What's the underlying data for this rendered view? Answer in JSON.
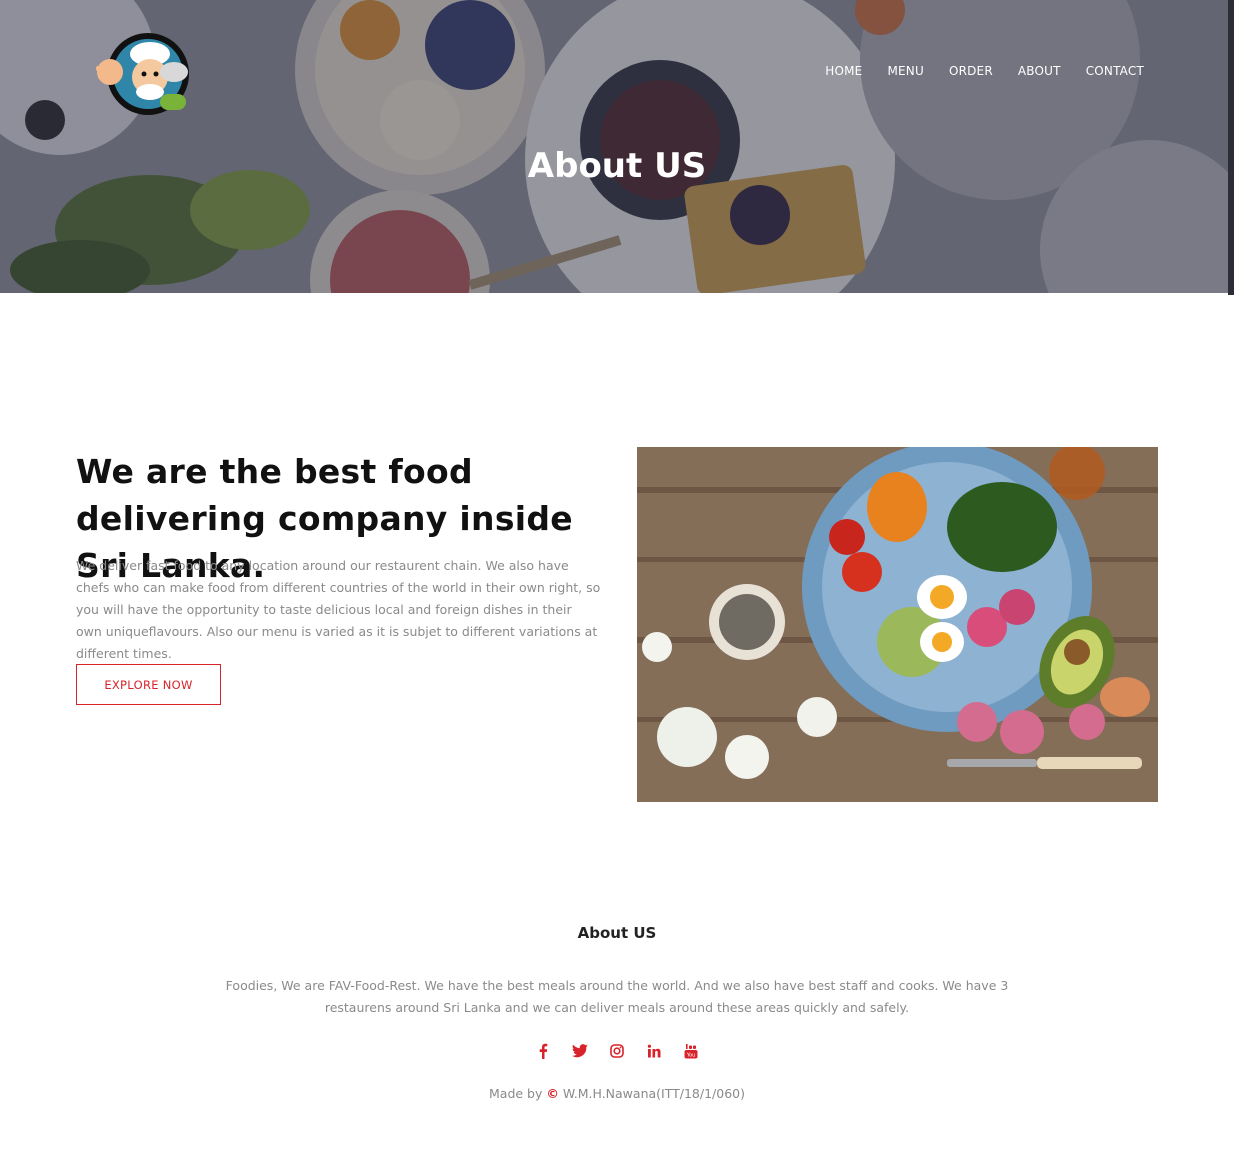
{
  "nav": {
    "items": [
      {
        "label": "HOME"
      },
      {
        "label": "MENU"
      },
      {
        "label": "ORDER"
      },
      {
        "label": "ABOUT"
      },
      {
        "label": "CONTACT"
      }
    ]
  },
  "hero": {
    "title": "About US"
  },
  "about": {
    "heading": "We are the best food delivering company inside Sri Lanka.",
    "text": "We deliver fast food to any location around our restaurent chain. We also have chefs who can make food from different countries of the world in their own right, so you will have the opportunity to taste delicious local and foreign dishes in their own uniqueflavours. Also our menu is varied as it is subjet to different variations at different times.",
    "button_label": "EXPLORE NOW"
  },
  "footer": {
    "title": "About US",
    "text": "Foodies, We are FAV-Food-Rest. We have the best meals around the world. And we also have best staff and cooks. We have 3 restaurens around Sri Lanka and we can deliver meals around these areas quickly and safely.",
    "socials": [
      {
        "icon": "facebook-icon"
      },
      {
        "icon": "twitter-icon"
      },
      {
        "icon": "instagram-icon"
      },
      {
        "icon": "linkedin-icon"
      },
      {
        "icon": "youtube-icon"
      }
    ],
    "credit_prefix": "Made by",
    "credit_symbol": "©",
    "credit_name": "W.M.H.Nawana(ITT/18/1/060)"
  },
  "colors": {
    "accent": "#d8232a",
    "hero_overlay": "#34364a",
    "muted_text": "#8a8a8a"
  }
}
